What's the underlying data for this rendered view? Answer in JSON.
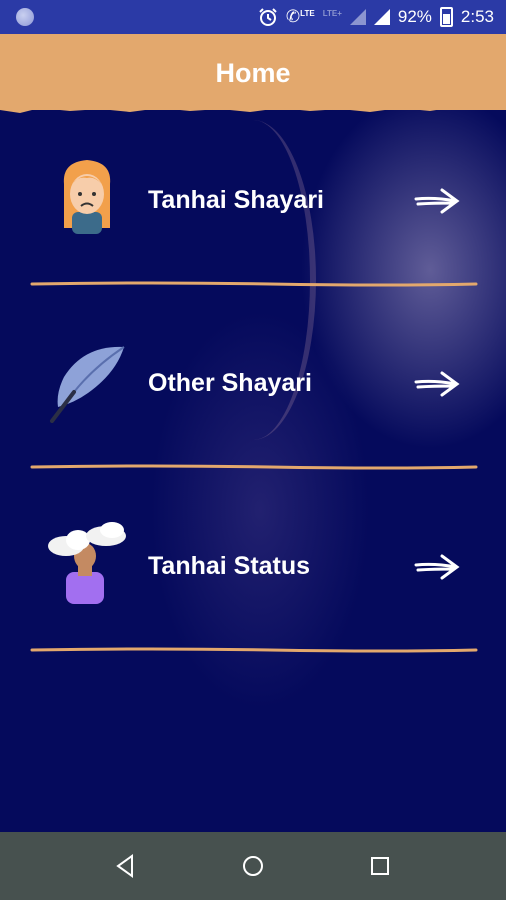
{
  "status_bar": {
    "network_label": "LTE",
    "network_label_2": "LTE+",
    "battery": "92%",
    "time": "2:53"
  },
  "app_bar": {
    "title": "Home",
    "color": "#e3a86d"
  },
  "menu": {
    "items": [
      {
        "label": "Tanhai Shayari",
        "icon": "sad-girl-icon"
      },
      {
        "label": "Other Shayari",
        "icon": "feather-icon"
      },
      {
        "label": "Tanhai Status",
        "icon": "cloud-head-person-icon"
      }
    ]
  },
  "colors": {
    "background": "#050a5c",
    "status_bar": "#2b3aa6",
    "divider": "#e3a86d",
    "nav_bar": "#47514f"
  }
}
